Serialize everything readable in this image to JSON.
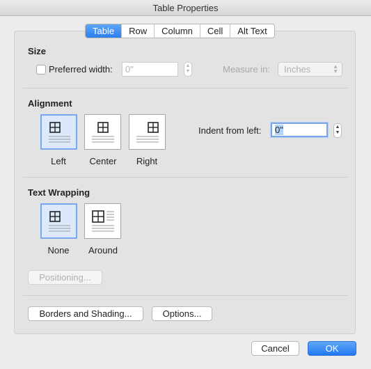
{
  "window": {
    "title": "Table Properties"
  },
  "tabs": [
    {
      "label": "Table",
      "active": true
    },
    {
      "label": "Row",
      "active": false
    },
    {
      "label": "Column",
      "active": false
    },
    {
      "label": "Cell",
      "active": false
    },
    {
      "label": "Alt Text",
      "active": false
    }
  ],
  "size": {
    "title": "Size",
    "preferred_width_label": "Preferred width:",
    "preferred_width_checked": false,
    "preferred_width_value": "0\"",
    "measure_in_label": "Measure in:",
    "measure_in_value": "Inches"
  },
  "alignment": {
    "title": "Alignment",
    "options": [
      "Left",
      "Center",
      "Right"
    ],
    "selected": "Left",
    "indent_label": "Indent from left:",
    "indent_value": "0\""
  },
  "text_wrapping": {
    "title": "Text Wrapping",
    "options": [
      "None",
      "Around"
    ],
    "selected": "None",
    "positioning_label": "Positioning..."
  },
  "buttons": {
    "borders": "Borders and Shading...",
    "options": "Options...",
    "cancel": "Cancel",
    "ok": "OK"
  },
  "colors": {
    "accent": "#2c7ff0",
    "selected_option_bg": "#dbe9fb"
  }
}
